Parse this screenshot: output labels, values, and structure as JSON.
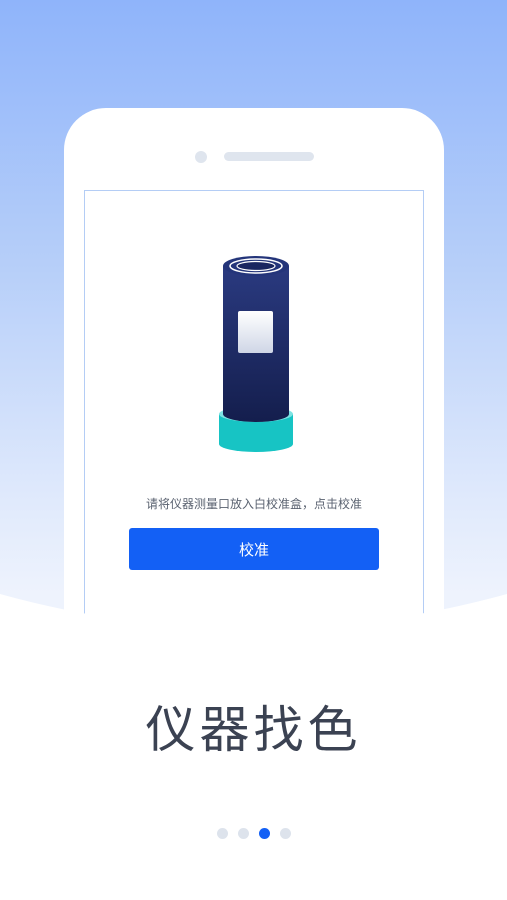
{
  "screen": {
    "instruction": "请将仪器测量口放入白校准盒，点击校准",
    "calibrate_button_label": "校准"
  },
  "feature": {
    "title": "仪器找色"
  },
  "pager": {
    "total": 4,
    "active_index": 2
  },
  "colors": {
    "accent": "#1360f5",
    "device_body": "#1b2a66",
    "device_base": "#17c4c4",
    "background_top": "#8fb4fa"
  }
}
